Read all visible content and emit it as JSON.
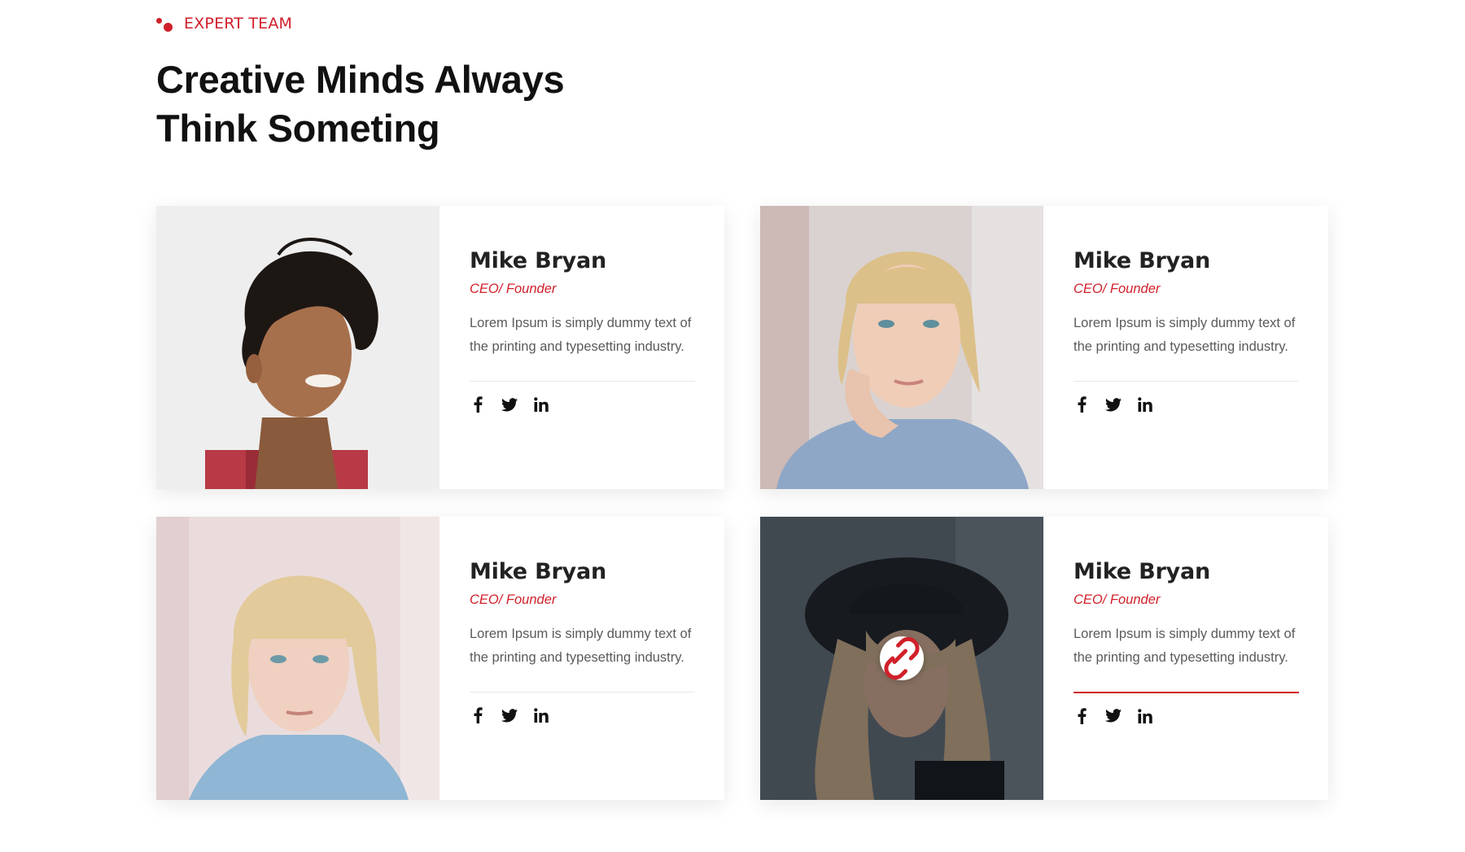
{
  "section": {
    "eyebrow": "EXPERT TEAM",
    "heading_line1": "Creative Minds Always",
    "heading_line2": "Think Someting"
  },
  "colors": {
    "accent": "#d0202a",
    "text": "#111111",
    "muted": "#5a5a5a"
  },
  "team": [
    {
      "name": "Mike Bryan",
      "role": "CEO/ Founder",
      "description": "Lorem Ipsum is simply dummy text of the printing and typesetting industry.",
      "photo": "young-man-curly-hair-portrait",
      "social": [
        "facebook-icon",
        "twitter-icon",
        "linkedin-icon"
      ]
    },
    {
      "name": "Mike Bryan",
      "role": "CEO/ Founder",
      "description": "Lorem Ipsum is simply dummy text of the printing and typesetting industry.",
      "photo": "blonde-woman-hand-on-cheek-portrait",
      "social": [
        "facebook-icon",
        "twitter-icon",
        "linkedin-icon"
      ]
    },
    {
      "name": "Mike Bryan",
      "role": "CEO/ Founder",
      "description": "Lorem Ipsum is simply dummy text of the printing and typesetting industry.",
      "photo": "blonde-woman-hoodie-portrait",
      "social": [
        "facebook-icon",
        "twitter-icon",
        "linkedin-icon"
      ]
    },
    {
      "name": "Mike Bryan",
      "role": "CEO/ Founder",
      "description": "Lorem Ipsum is simply dummy text of the printing and typesetting industry.",
      "photo": "woman-black-hat-portrait",
      "hover_icon": "link-icon",
      "social": [
        "facebook-icon",
        "twitter-icon",
        "linkedin-icon"
      ]
    }
  ]
}
